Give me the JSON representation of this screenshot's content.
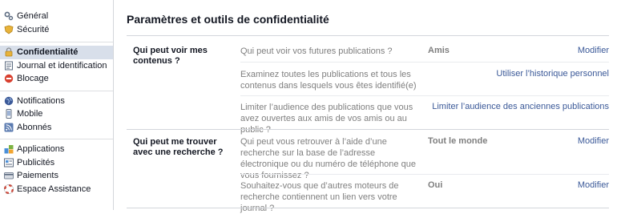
{
  "sidebar": {
    "groups": [
      [
        {
          "label": "Général",
          "icon": "gear-icon"
        },
        {
          "label": "Sécurité",
          "icon": "shield-icon"
        }
      ],
      [
        {
          "label": "Confidentialité",
          "icon": "lock-icon",
          "active": true
        },
        {
          "label": "Journal et identification",
          "icon": "timeline-icon"
        },
        {
          "label": "Blocage",
          "icon": "block-icon"
        }
      ],
      [
        {
          "label": "Notifications",
          "icon": "globe-icon"
        },
        {
          "label": "Mobile",
          "icon": "mobile-icon"
        },
        {
          "label": "Abonnés",
          "icon": "rss-icon"
        }
      ],
      [
        {
          "label": "Applications",
          "icon": "apps-icon"
        },
        {
          "label": "Publicités",
          "icon": "ads-icon"
        },
        {
          "label": "Paiements",
          "icon": "payment-icon"
        },
        {
          "label": "Espace Assistance",
          "icon": "lifebuoy-icon"
        }
      ]
    ]
  },
  "main": {
    "title": "Paramètres et outils de confidentialité",
    "sections": [
      {
        "heading": "Qui peut voir mes contenus ?",
        "rows": [
          {
            "question": "Qui peut voir vos futures publications ?",
            "value": "Amis",
            "link": "Modifier"
          },
          {
            "question": "Examinez toutes les publications et tous les contenus dans lesquels vous êtes identifié(e)",
            "value": "",
            "link": "Utiliser l’historique personnel"
          },
          {
            "question": "Limiter l’audience des publications que vous avez ouvertes aux amis de vos amis ou au public ?",
            "value": "",
            "link": "Limiter l’audience des anciennes publications"
          }
        ]
      },
      {
        "heading": "Qui peut me trouver avec une recherche ?",
        "rows": [
          {
            "question": "Qui peut vous retrouver à l’aide d’une recherche sur la base de l’adresse électronique ou du numéro de téléphone que vous fournissez ?",
            "value": "Tout le monde",
            "link": "Modifier"
          },
          {
            "question": "Souhaitez-vous que d’autres moteurs de recherche contiennent un lien vers votre journal ?",
            "value": "Oui",
            "link": "Modifier"
          }
        ]
      }
    ]
  }
}
